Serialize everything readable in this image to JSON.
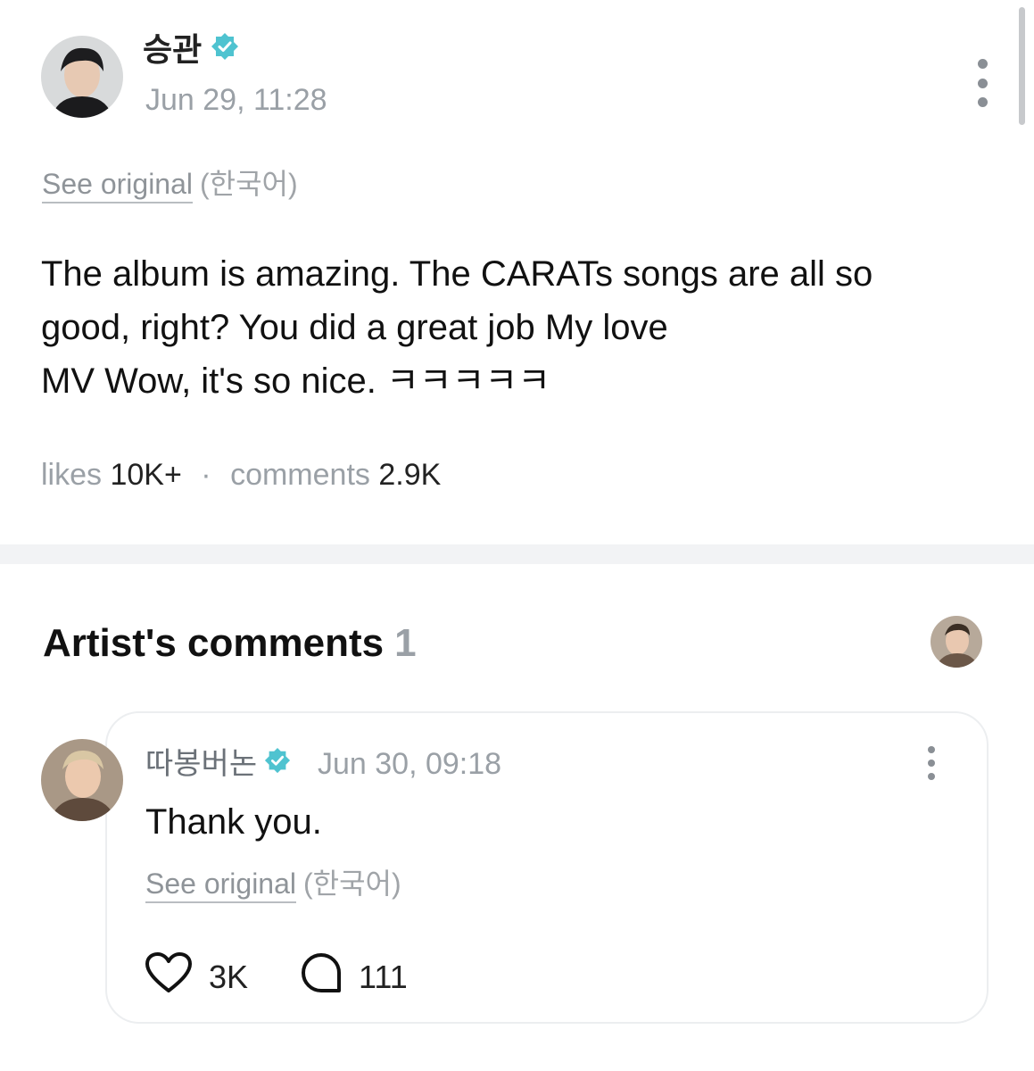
{
  "post": {
    "author": "승관",
    "timestamp": "Jun 29, 11:28",
    "see_original": "See original",
    "language": "(한국어)",
    "body": "The album is amazing. The CARATs songs are all so\ngood, right? You did a great job My love\nMV Wow, it's so nice. ㅋㅋㅋㅋㅋ",
    "likes_label": "likes",
    "likes_value": "10K+",
    "separator": "·",
    "comments_label": "comments",
    "comments_value": "2.9K"
  },
  "artist_comments": {
    "title": "Artist's comments",
    "count": "1"
  },
  "comment": {
    "author": "따봉버논",
    "timestamp": "Jun 30, 09:18",
    "text": "Thank you.",
    "see_original": "See original",
    "language": "(한국어)",
    "likes": "3K",
    "replies": "111"
  },
  "colors": {
    "verified_badge": "#4fc3d0",
    "accent_text": "#111111",
    "muted_text": "#9aa0a6"
  },
  "icons": [
    "verified-badge-icon",
    "more-options-icon",
    "heart-icon",
    "reply-bubble-icon"
  ]
}
